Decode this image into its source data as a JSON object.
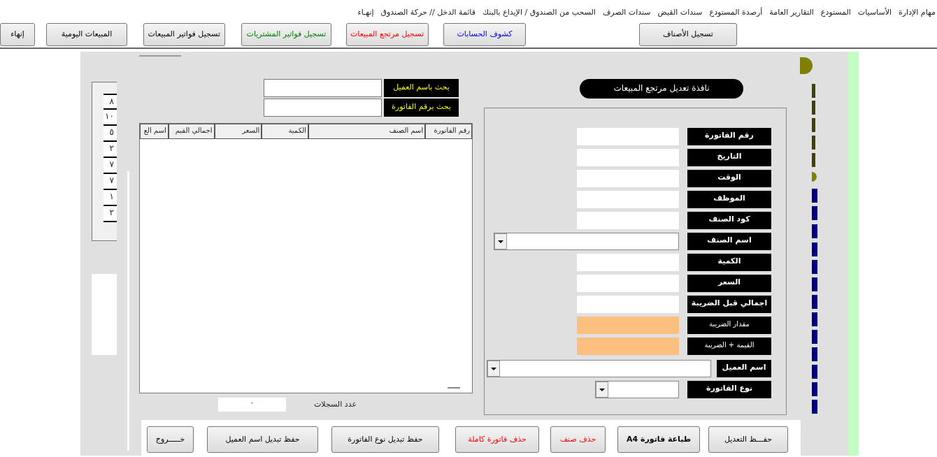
{
  "menu": [
    "مهام الإدارة",
    "الأساسيات",
    "المستودع",
    "التقارير العامة",
    "أرصدة المستودع",
    "سندات القبض",
    "سندات الصرف",
    "السحب من الصندوق / الإيداع بالبنك",
    "قائمة الدخل  //  حركة الصندوق",
    "إنهـاء"
  ],
  "toolbar": [
    {
      "label": "تسجيل الأصناف",
      "color": "#000000"
    },
    {
      "label": "كشوف الحسابات",
      "color": "#0000ff"
    },
    {
      "label": "تسجيل مرتجع المبيعات",
      "color": "#ff0000"
    },
    {
      "label": "تسجيل فواتير المشتريات",
      "color": "#008000"
    },
    {
      "label": "تسجيل فواتير المبيعات",
      "color": "#000000"
    },
    {
      "label": "المبيعات اليومية",
      "color": "#000000"
    },
    {
      "label": "إنهاء",
      "color": "#000000"
    }
  ],
  "side_list": [
    "٨",
    "١٠",
    "٥",
    "٢",
    "٧",
    "٧",
    "١",
    "٢"
  ],
  "search": [
    {
      "label": "بحث باسم العميل"
    },
    {
      "label": "بحث  برقم الفاتورة"
    }
  ],
  "table": {
    "columns": [
      "رقم الفاتورة",
      "اسم الصنف",
      "الكمية",
      "السعر",
      "اجمالي القيم",
      "اسم الع"
    ]
  },
  "record_count": {
    "label": "عدد السجلات",
    "value": "٠"
  },
  "title": "نافذة تعديل مرتجع المبيعات",
  "fields": [
    {
      "label": "رقم الفاتورة",
      "kind": "text"
    },
    {
      "label": "التاريخ",
      "kind": "text"
    },
    {
      "label": "الوقت",
      "kind": "text"
    },
    {
      "label": "الموظف",
      "kind": "text"
    },
    {
      "label": "كود الصنف",
      "kind": "text"
    },
    {
      "label": "اسم الصنف",
      "kind": "combo"
    },
    {
      "label": "الكمية",
      "kind": "text"
    },
    {
      "label": "السعر",
      "kind": "text"
    },
    {
      "label": "اجمالي قبل الضريبة",
      "kind": "text"
    },
    {
      "label": "مقدار الضريبة",
      "kind": "computed"
    },
    {
      "label": "القيمة + الضريبة",
      "kind": "computed"
    },
    {
      "label": "اسم العميل",
      "kind": "lookup"
    },
    {
      "label": "نوع الفاتورة",
      "kind": "select"
    }
  ],
  "buttons": [
    {
      "label": "حفـــظ التعديل",
      "color": "#000000",
      "bold": false
    },
    {
      "label": "طباعة فاتورة A4",
      "color": "#000000",
      "bold": true
    },
    {
      "label": "حذف صنف",
      "color": "#ff0000",
      "bold": false
    },
    {
      "label": "حذف فاتورة كاملة",
      "color": "#ff0000",
      "bold": false
    },
    {
      "label": "حفظ تبديل نوع الفاتورة",
      "color": "#000000",
      "bold": false
    },
    {
      "label": "حفظ تبديل اسم العميل",
      "color": "#000000",
      "bold": false
    },
    {
      "label": "خـــــروج",
      "color": "#000000",
      "bold": false
    }
  ]
}
